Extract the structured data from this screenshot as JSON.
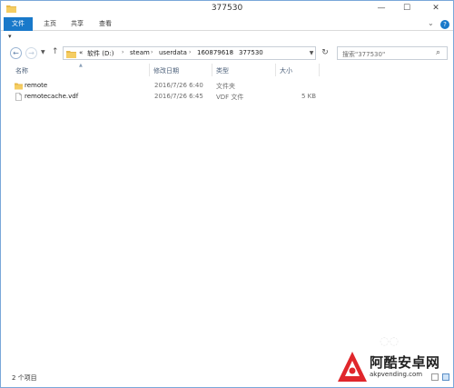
{
  "window": {
    "title": "377530",
    "controls": {
      "minimize": "—",
      "maximize": "☐",
      "close": "✕"
    }
  },
  "ribbon": {
    "tabs": [
      "文件",
      "主页",
      "共享",
      "查看"
    ],
    "expand_icon": "chevron-down",
    "help_label": "?"
  },
  "quick_access": {
    "pin_icon": "▾"
  },
  "nav": {
    "back_icon": "arrow-left",
    "forward_icon": "arrow-right",
    "recent_icon": "chevron-down",
    "up_icon": "arrow-up",
    "overflow": "«",
    "breadcrumbs": [
      "软件 (D:)",
      "steam",
      "userdata",
      "160879618",
      "377530"
    ],
    "refresh_icon": "refresh"
  },
  "search": {
    "placeholder": "搜索\"377530\""
  },
  "columns": {
    "name": "名称",
    "date": "修改日期",
    "type": "类型",
    "size": "大小"
  },
  "files": [
    {
      "name": "remote",
      "date": "2016/7/26 6:40",
      "type": "文件夹",
      "size": "",
      "icon": "folder-icon"
    },
    {
      "name": "remotecache.vdf",
      "date": "2016/7/26 6:45",
      "type": "VDF 文件",
      "size": "5 KB",
      "icon": "file-icon"
    }
  ],
  "status": {
    "item_count": "2 个项目"
  },
  "watermark": {
    "title": "阿酷安卓网",
    "url": "akpvending.com"
  },
  "colors": {
    "accent": "#1979ca",
    "watermark_red": "#e0262b"
  }
}
